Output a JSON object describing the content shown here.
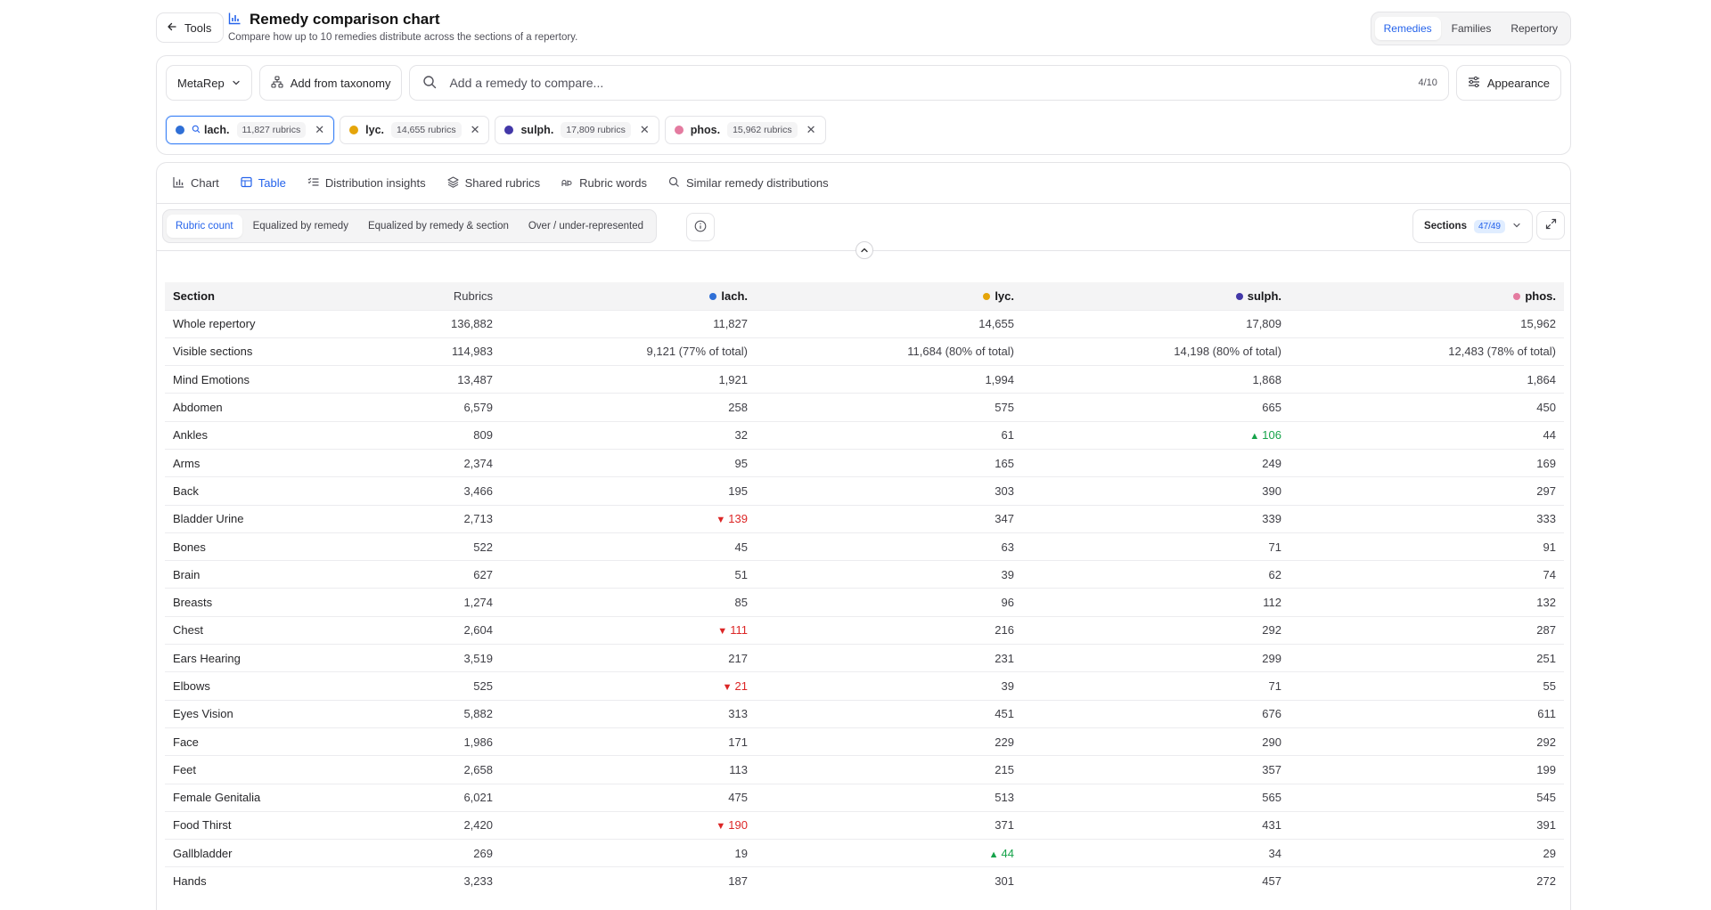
{
  "header": {
    "back_label": "Tools",
    "title": "Remedy comparison chart",
    "subtitle": "Compare how up to 10 remedies distribute across the sections of a repertory.",
    "view_tabs": [
      {
        "label": "Remedies",
        "active": true
      },
      {
        "label": "Families",
        "active": false
      },
      {
        "label": "Repertory",
        "active": false
      }
    ]
  },
  "controls": {
    "repertory": "MetaRep",
    "add_taxonomy": "Add from taxonomy",
    "search_placeholder": "Add a remedy to compare...",
    "count": "4/10",
    "appearance": "Appearance"
  },
  "remedies": [
    {
      "name": "lach.",
      "rubrics": "11,827 rubrics",
      "color": "#2f6fd6",
      "active": true
    },
    {
      "name": "lyc.",
      "rubrics": "14,655 rubrics",
      "color": "#e5a50a",
      "active": false
    },
    {
      "name": "sulph.",
      "rubrics": "17,809 rubrics",
      "color": "#4338a8",
      "active": false
    },
    {
      "name": "phos.",
      "rubrics": "15,962 rubrics",
      "color": "#e47ba0",
      "active": false
    }
  ],
  "tabs": [
    {
      "label": "Chart",
      "icon": "bar-chart-icon",
      "active": false
    },
    {
      "label": "Table",
      "icon": "table-icon",
      "active": true
    },
    {
      "label": "Distribution insights",
      "icon": "list-check-icon",
      "active": false
    },
    {
      "label": "Shared rubrics",
      "icon": "layers-icon",
      "active": false
    },
    {
      "label": "Rubric words",
      "icon": "words-icon",
      "active": false
    },
    {
      "label": "Similar remedy distributions",
      "icon": "search-icon",
      "active": false
    }
  ],
  "modes": [
    {
      "label": "Rubric count",
      "active": true
    },
    {
      "label": "Equalized by remedy",
      "active": false
    },
    {
      "label": "Equalized by remedy & section",
      "active": false
    },
    {
      "label": "Over / under-represented",
      "active": false
    }
  ],
  "sections_filter": {
    "label": "Sections",
    "count": "47/49"
  },
  "table": {
    "headers": {
      "section": "Section",
      "rubrics": "Rubrics",
      "remedies": [
        "lach.",
        "lyc.",
        "sulph.",
        "phos."
      ]
    },
    "rows": [
      {
        "section": "Whole repertory",
        "rubrics": "136,882",
        "cells": [
          {
            "v": "11,827"
          },
          {
            "v": "14,655"
          },
          {
            "v": "17,809"
          },
          {
            "v": "15,962"
          }
        ]
      },
      {
        "section": "Visible sections",
        "rubrics": "114,983",
        "cells": [
          {
            "v": "9,121 (77% of total)"
          },
          {
            "v": "11,684 (80% of total)"
          },
          {
            "v": "14,198 (80% of total)"
          },
          {
            "v": "12,483 (78% of total)"
          }
        ]
      },
      {
        "section": "Mind Emotions",
        "rubrics": "13,487",
        "cells": [
          {
            "v": "1,921"
          },
          {
            "v": "1,994"
          },
          {
            "v": "1,868"
          },
          {
            "v": "1,864"
          }
        ]
      },
      {
        "section": "Abdomen",
        "rubrics": "6,579",
        "cells": [
          {
            "v": "258"
          },
          {
            "v": "575"
          },
          {
            "v": "665"
          },
          {
            "v": "450"
          }
        ]
      },
      {
        "section": "Ankles",
        "rubrics": "809",
        "cells": [
          {
            "v": "32"
          },
          {
            "v": "61"
          },
          {
            "v": "106",
            "t": "up"
          },
          {
            "v": "44"
          }
        ]
      },
      {
        "section": "Arms",
        "rubrics": "2,374",
        "cells": [
          {
            "v": "95"
          },
          {
            "v": "165"
          },
          {
            "v": "249"
          },
          {
            "v": "169"
          }
        ]
      },
      {
        "section": "Back",
        "rubrics": "3,466",
        "cells": [
          {
            "v": "195"
          },
          {
            "v": "303"
          },
          {
            "v": "390"
          },
          {
            "v": "297"
          }
        ]
      },
      {
        "section": "Bladder Urine",
        "rubrics": "2,713",
        "cells": [
          {
            "v": "139",
            "t": "down"
          },
          {
            "v": "347"
          },
          {
            "v": "339"
          },
          {
            "v": "333"
          }
        ]
      },
      {
        "section": "Bones",
        "rubrics": "522",
        "cells": [
          {
            "v": "45"
          },
          {
            "v": "63"
          },
          {
            "v": "71"
          },
          {
            "v": "91"
          }
        ]
      },
      {
        "section": "Brain",
        "rubrics": "627",
        "cells": [
          {
            "v": "51"
          },
          {
            "v": "39"
          },
          {
            "v": "62"
          },
          {
            "v": "74"
          }
        ]
      },
      {
        "section": "Breasts",
        "rubrics": "1,274",
        "cells": [
          {
            "v": "85"
          },
          {
            "v": "96"
          },
          {
            "v": "112"
          },
          {
            "v": "132"
          }
        ]
      },
      {
        "section": "Chest",
        "rubrics": "2,604",
        "cells": [
          {
            "v": "111",
            "t": "down"
          },
          {
            "v": "216"
          },
          {
            "v": "292"
          },
          {
            "v": "287"
          }
        ]
      },
      {
        "section": "Ears Hearing",
        "rubrics": "3,519",
        "cells": [
          {
            "v": "217"
          },
          {
            "v": "231"
          },
          {
            "v": "299"
          },
          {
            "v": "251"
          }
        ]
      },
      {
        "section": "Elbows",
        "rubrics": "525",
        "cells": [
          {
            "v": "21",
            "t": "down"
          },
          {
            "v": "39"
          },
          {
            "v": "71"
          },
          {
            "v": "55"
          }
        ]
      },
      {
        "section": "Eyes Vision",
        "rubrics": "5,882",
        "cells": [
          {
            "v": "313"
          },
          {
            "v": "451"
          },
          {
            "v": "676"
          },
          {
            "v": "611"
          }
        ]
      },
      {
        "section": "Face",
        "rubrics": "1,986",
        "cells": [
          {
            "v": "171"
          },
          {
            "v": "229"
          },
          {
            "v": "290"
          },
          {
            "v": "292"
          }
        ]
      },
      {
        "section": "Feet",
        "rubrics": "2,658",
        "cells": [
          {
            "v": "113"
          },
          {
            "v": "215"
          },
          {
            "v": "357"
          },
          {
            "v": "199"
          }
        ]
      },
      {
        "section": "Female Genitalia",
        "rubrics": "6,021",
        "cells": [
          {
            "v": "475"
          },
          {
            "v": "513"
          },
          {
            "v": "565"
          },
          {
            "v": "545"
          }
        ]
      },
      {
        "section": "Food Thirst",
        "rubrics": "2,420",
        "cells": [
          {
            "v": "190",
            "t": "down"
          },
          {
            "v": "371"
          },
          {
            "v": "431"
          },
          {
            "v": "391"
          }
        ]
      },
      {
        "section": "Gallbladder",
        "rubrics": "269",
        "cells": [
          {
            "v": "19"
          },
          {
            "v": "44",
            "t": "up"
          },
          {
            "v": "34"
          },
          {
            "v": "29"
          }
        ]
      },
      {
        "section": "Hands",
        "rubrics": "3,233",
        "cells": [
          {
            "v": "187"
          },
          {
            "v": "301"
          },
          {
            "v": "457"
          },
          {
            "v": "272"
          }
        ]
      }
    ]
  }
}
